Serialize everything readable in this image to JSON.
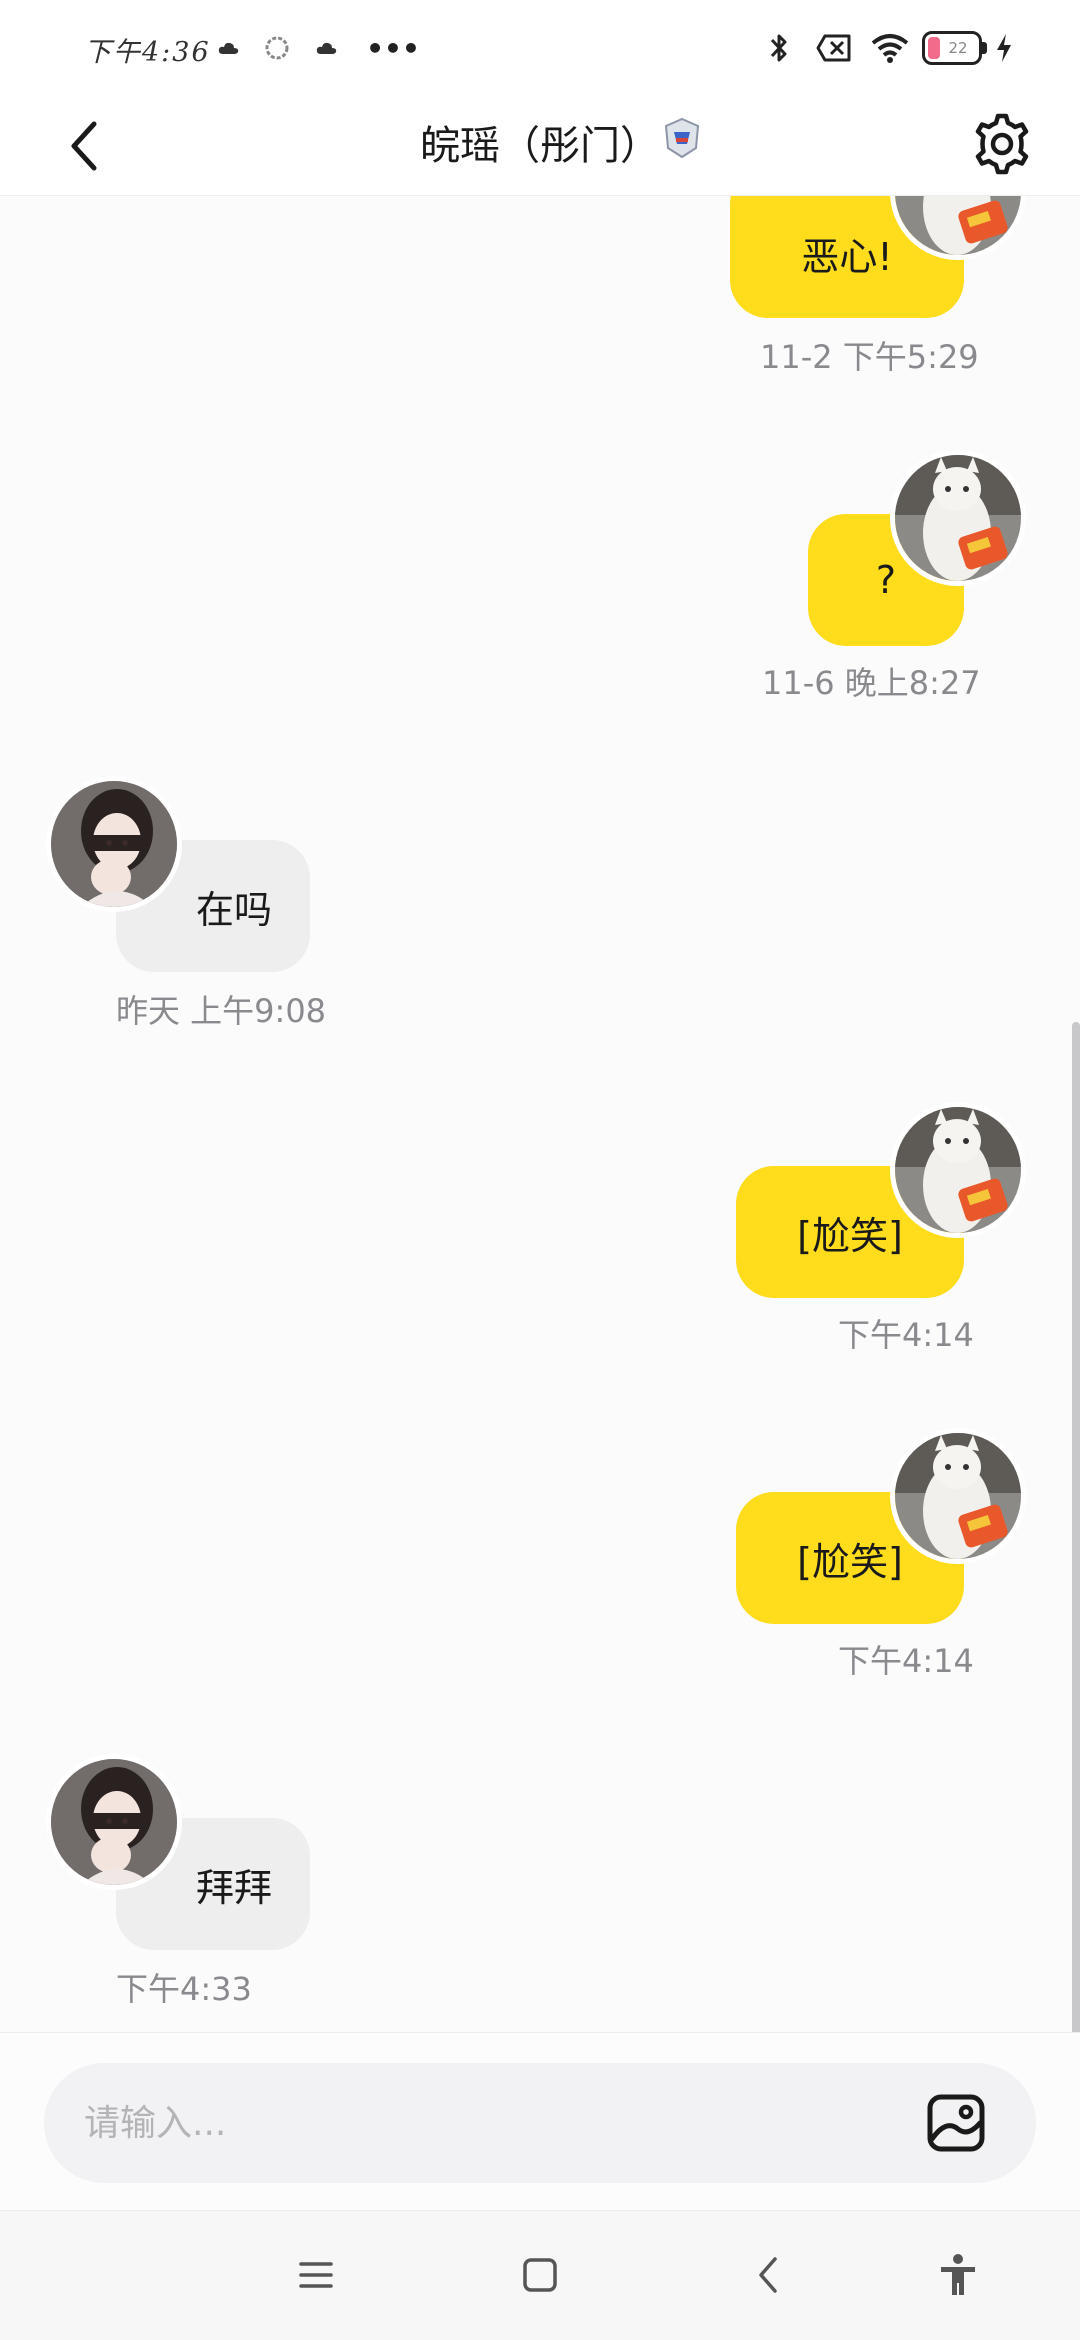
{
  "status_bar": {
    "time": "下午4:36",
    "more_dots": "•••",
    "battery_level": "22",
    "colors": {
      "battery_fill": "#f26b8a"
    }
  },
  "header": {
    "title": "皖瑶（彤门）",
    "back_icon": "chevron-left-icon",
    "settings_icon": "gear-icon"
  },
  "messages": [
    {
      "side": "out",
      "text": "恶心!",
      "time": "11-2 下午5:29"
    },
    {
      "side": "out",
      "text": "?",
      "time": "11-6 晚上8:27"
    },
    {
      "side": "in",
      "text": "在吗",
      "time": "昨天 上午9:08"
    },
    {
      "side": "out",
      "text": "[尬笑]",
      "time": "下午4:14"
    },
    {
      "side": "out",
      "text": "[尬笑]",
      "time": "下午4:14"
    },
    {
      "side": "in",
      "text": "拜拜",
      "time": "下午4:33"
    }
  ],
  "composer": {
    "placeholder": "请输入...",
    "image_icon": "image-icon"
  },
  "system_nav": {
    "icons": [
      "menu-icon",
      "home-icon",
      "back-icon",
      "accessibility-icon"
    ]
  },
  "colors": {
    "outgoing_bubble": "#ffdc1c",
    "incoming_bubble": "#eeeeef",
    "timestamp": "#8a8a8e"
  }
}
